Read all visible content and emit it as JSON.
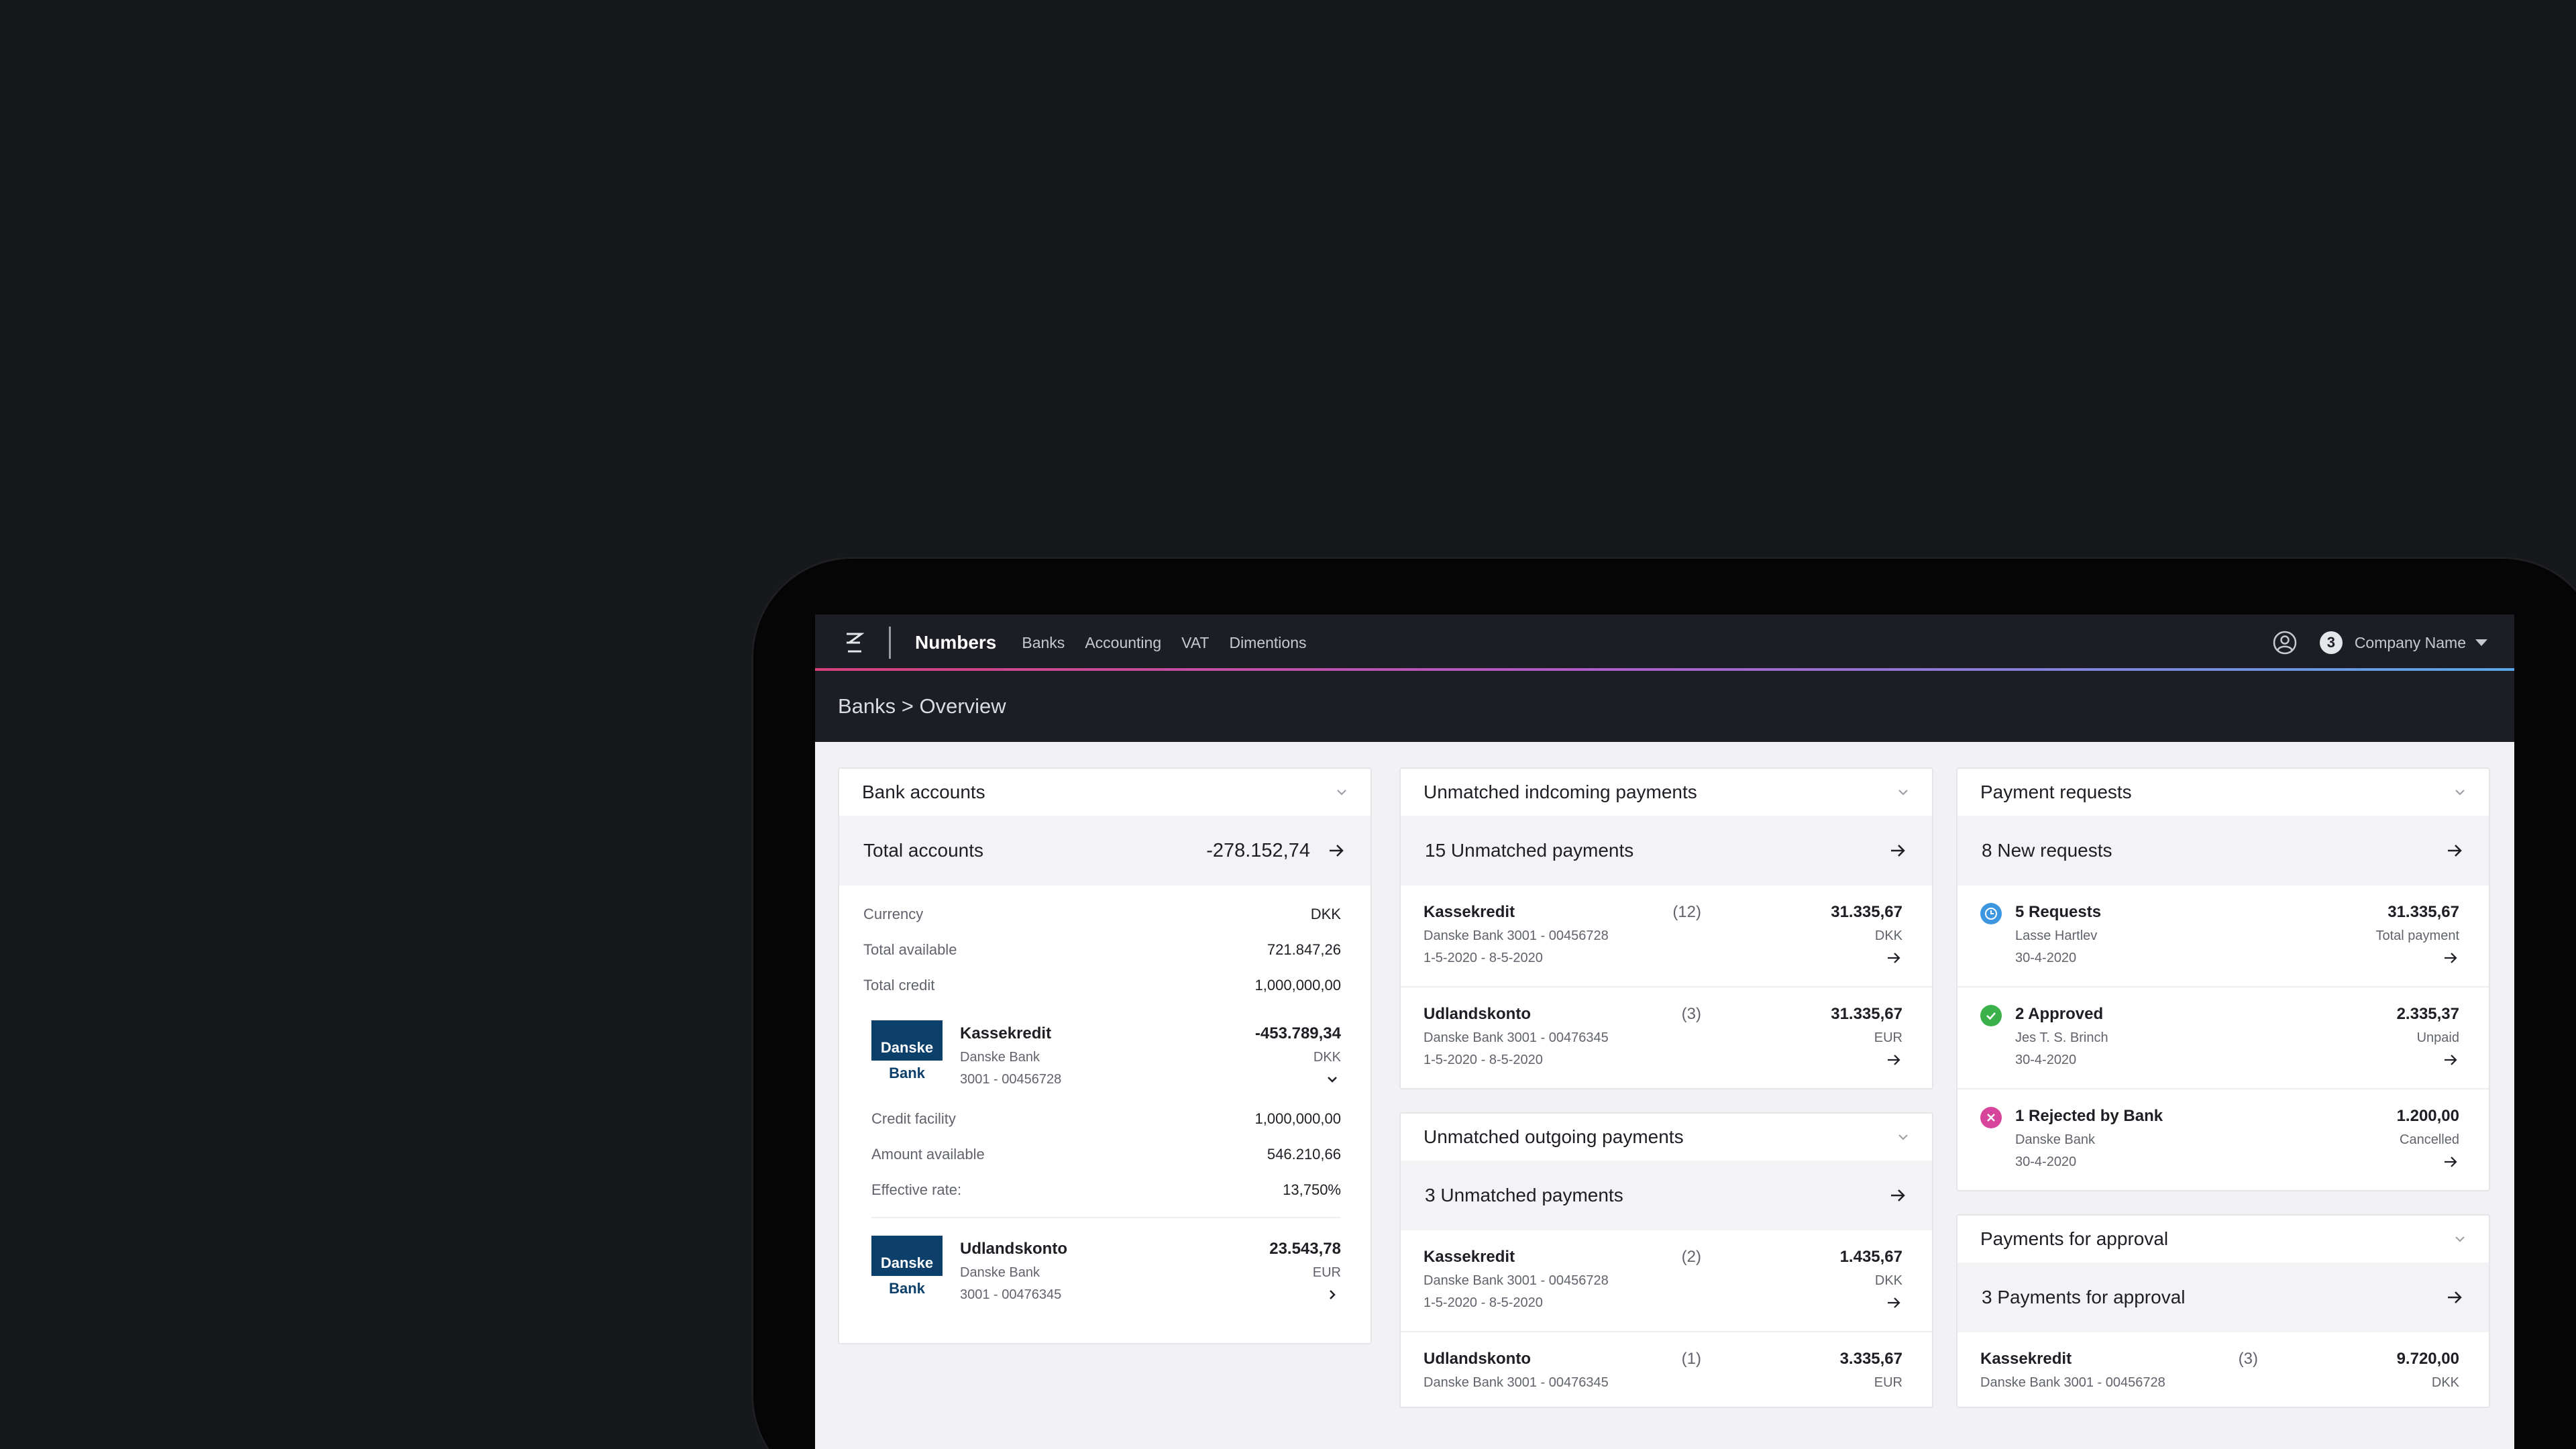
{
  "colors": {
    "accent_pink": "#d8407c",
    "accent_blue": "#5aa7e8",
    "bank_blue": "#0d3f6b",
    "status_requests": "#3d97e0",
    "status_approved": "#3cb04a",
    "status_rejected": "#d6449b"
  },
  "nav": {
    "brand": "Numbers",
    "links": [
      "Banks",
      "Accounting",
      "VAT",
      "Dimentions"
    ],
    "notification_count": "3",
    "company": "Company Name"
  },
  "breadcrumb": "Banks > Overview",
  "bank_accounts": {
    "title": "Bank accounts",
    "summary_label": "Total accounts",
    "summary_value": "-278.152,74",
    "details": [
      {
        "k": "Currency",
        "v": "DKK"
      },
      {
        "k": "Total available",
        "v": "721.847,26"
      },
      {
        "k": "Total credit",
        "v": "1,000,000,00"
      }
    ],
    "bank_logo_top": "Danske",
    "bank_logo_bottom": "Bank",
    "accounts": [
      {
        "name": "Kassekredit",
        "bank": "Danske Bank",
        "number": "3001 - 00456728",
        "amount": "-453.789,34",
        "currency": "DKK"
      },
      {
        "name": "Udlandskonto",
        "bank": "Danske Bank",
        "number": "3001 - 00476345",
        "amount": "23.543,78",
        "currency": "EUR"
      }
    ],
    "account_details": [
      {
        "k": "Credit facility",
        "v": "1,000,000,00"
      },
      {
        "k": "Amount available",
        "v": "546.210,66"
      },
      {
        "k": "Effective rate:",
        "v": "13,750%"
      }
    ]
  },
  "incoming": {
    "title": "Unmatched indcoming payments",
    "summary": "15 Unmatched payments",
    "rows": [
      {
        "name": "Kassekredit",
        "sub": "Danske Bank  3001 - 00456728",
        "dates": "1-5-2020 - 8-5-2020",
        "count": "(12)",
        "amount": "31.335,67",
        "currency": "DKK"
      },
      {
        "name": "Udlandskonto",
        "sub": "Danske Bank  3001 - 00476345",
        "dates": "1-5-2020 - 8-5-2020",
        "count": "(3)",
        "amount": "31.335,67",
        "currency": "EUR"
      }
    ]
  },
  "outgoing": {
    "title": "Unmatched outgoing payments",
    "summary": "3 Unmatched payments",
    "rows": [
      {
        "name": "Kassekredit",
        "sub": "Danske Bank  3001 - 00456728",
        "dates": "1-5-2020 - 8-5-2020",
        "count": "(2)",
        "amount": "1.435,67",
        "currency": "DKK"
      },
      {
        "name": "Udlandskonto",
        "sub": "Danske Bank  3001 - 00476345",
        "count": "(1)",
        "amount": "3.335,67",
        "currency": "EUR"
      }
    ]
  },
  "requests": {
    "title": "Payment requests",
    "summary": "8 New requests",
    "rows": [
      {
        "name": "5 Requests",
        "sub": "Lasse Hartlev",
        "date": "30-4-2020",
        "amount": "31.335,67",
        "note": "Total payment",
        "icon": "clock-icon"
      },
      {
        "name": "2 Approved",
        "sub": "Jes T. S. Brinch",
        "date": "30-4-2020",
        "amount": "2.335,37",
        "note": "Unpaid",
        "icon": "check-icon"
      },
      {
        "name": "1 Rejected by Bank",
        "sub": "Danske Bank",
        "date": "30-4-2020",
        "amount": "1.200,00",
        "note": "Cancelled",
        "icon": "x-icon"
      }
    ]
  },
  "approval": {
    "title": "Payments for approval",
    "summary": "3 Payments for approval",
    "rows": [
      {
        "name": "Kassekredit",
        "sub": "Danske Bank  3001 - 00456728",
        "count": "(3)",
        "amount": "9.720,00",
        "currency": "DKK"
      }
    ]
  }
}
